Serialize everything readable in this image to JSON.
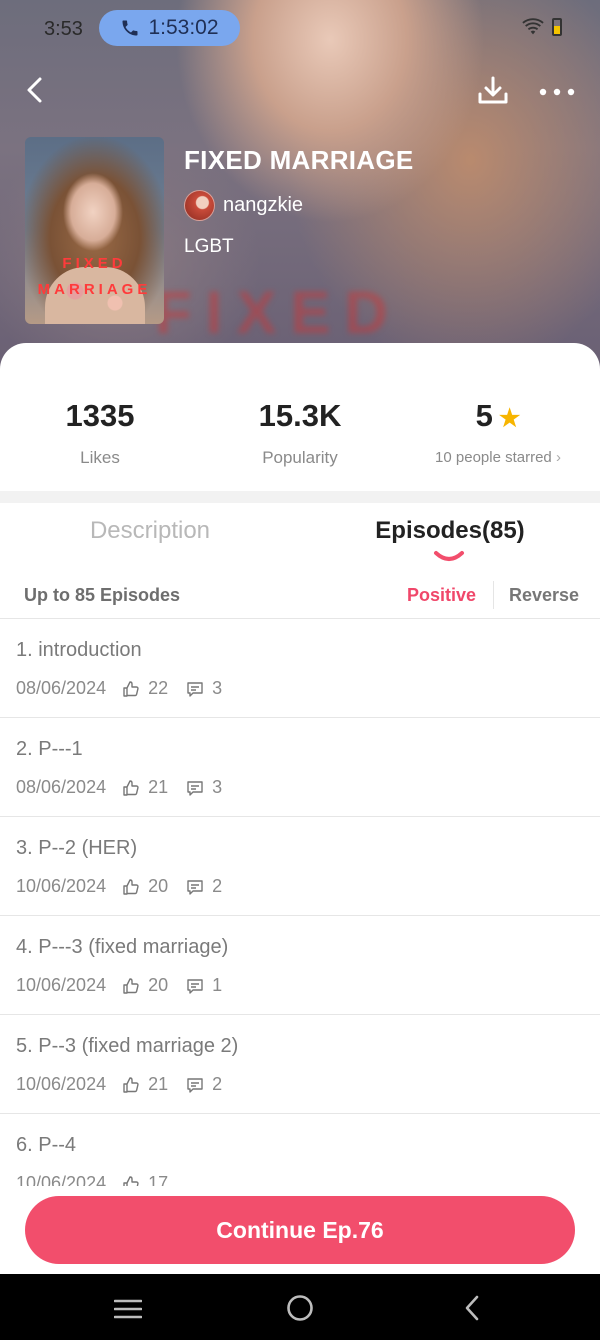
{
  "status_bar": {
    "time": "3:53",
    "call_timer": "1:53:02"
  },
  "book": {
    "title": "FIXED MARRIAGE",
    "author": "nangzkie",
    "tag": "LGBT",
    "cover_text_line1": "FIXED",
    "cover_text_line2": "MARRIAGE",
    "hero_background_text": "FIXED"
  },
  "stats": {
    "likes_value": "1335",
    "likes_label": "Likes",
    "popularity_value": "15.3K",
    "popularity_label": "Popularity",
    "rating_value": "5",
    "rating_label": "10 people starred",
    "rating_chevron": "›"
  },
  "tabs": {
    "description": "Description",
    "episodes": "Episodes(85)"
  },
  "episodes_header": {
    "count_text": "Up to 85 Episodes",
    "positive": "Positive",
    "reverse": "Reverse"
  },
  "episodes": [
    {
      "title": "1. introduction",
      "date": "08/06/2024",
      "likes": "22",
      "comments": "3"
    },
    {
      "title": "2. P---1",
      "date": "08/06/2024",
      "likes": "21",
      "comments": "3"
    },
    {
      "title": "3. P--2 (HER)",
      "date": "10/06/2024",
      "likes": "20",
      "comments": "2"
    },
    {
      "title": "4. P---3 (fixed marriage)",
      "date": "10/06/2024",
      "likes": "20",
      "comments": "1"
    },
    {
      "title": "5. P--3 (fixed marriage 2)",
      "date": "10/06/2024",
      "likes": "21",
      "comments": "2"
    },
    {
      "title": "6. P--4",
      "date": "10/06/2024",
      "likes": "17",
      "comments": ""
    }
  ],
  "continue_button": "Continue Ep.76",
  "colors": {
    "accent": "#f24e6c",
    "star": "#f7b500",
    "call_pill": "#7aa7ee"
  }
}
